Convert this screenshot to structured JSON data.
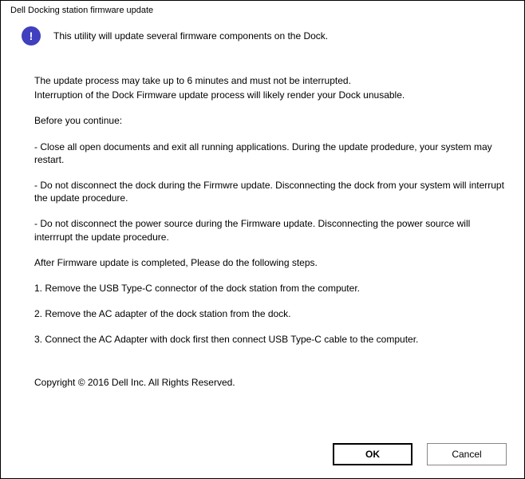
{
  "title": "Dell Docking station firmware update",
  "header_text": "This utility will update several firmware components on the Dock.",
  "content": {
    "line1": "The update process may take up to 6 minutes and must not be interrupted.",
    "line2": "Interruption of the Dock Firmware update process will likely render your Dock unusable.",
    "before": "Before you continue:",
    "bullet1": "- Close all open documents and exit all running applications. During the update prodedure, your system may restart.",
    "bullet2": "- Do not disconnect the dock during the Firmwre update. Disconnecting the dock from your system will interrupt the update procedure.",
    "bullet3": "- Do not disconnect the power source during the Firmware update. Disconnecting the power source will interrrupt the update procedure.",
    "after": "After Firmware update is completed, Please do the following steps.",
    "step1": "1. Remove the USB Type-C connector of the dock station from the computer.",
    "step2": "2. Remove the AC adapter of the dock station from the dock.",
    "step3": "3. Connect the AC Adapter with dock first then connect USB Type-C cable to the computer.",
    "copyright": "Copyright © 2016 Dell Inc. All Rights Reserved."
  },
  "buttons": {
    "ok": "OK",
    "cancel": "Cancel"
  }
}
